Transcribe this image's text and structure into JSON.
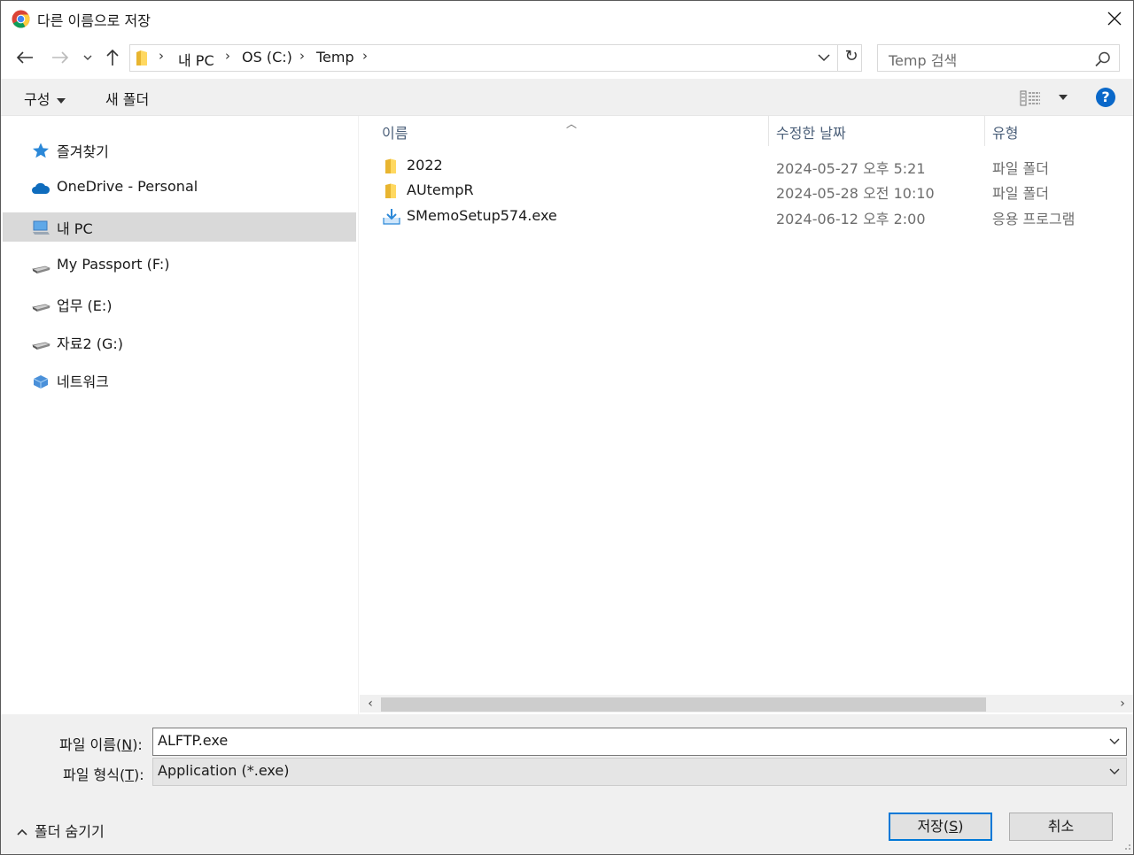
{
  "window": {
    "title": "다른 이름으로 저장",
    "close_icon": "close-icon"
  },
  "nav": {
    "breadcrumbs": [
      "내 PC",
      "OS (C:)",
      "Temp"
    ],
    "search_placeholder": "Temp 검색"
  },
  "toolbar": {
    "organize_label": "구성",
    "new_folder_label": "새 폴더",
    "help_label": "?"
  },
  "sidebar": {
    "items": [
      {
        "label": "즐겨찾기",
        "icon": "star-icon"
      },
      {
        "label": "OneDrive - Personal",
        "icon": "cloud-icon"
      },
      {
        "label": "내 PC",
        "icon": "computer-icon",
        "selected": true
      },
      {
        "label": "My Passport (F:)",
        "icon": "drive-icon"
      },
      {
        "label": "업무 (E:)",
        "icon": "drive-icon"
      },
      {
        "label": "자료2 (G:)",
        "icon": "drive-icon"
      },
      {
        "label": "네트워크",
        "icon": "network-icon"
      }
    ]
  },
  "filelist": {
    "columns": {
      "name": "이름",
      "date": "수정한 날짜",
      "type": "유형"
    },
    "rows": [
      {
        "name": "2022",
        "date": "2024-05-27 오후 5:21",
        "type": "파일 폴더",
        "icon": "folder-icon"
      },
      {
        "name": "AUtempR",
        "date": "2024-05-28 오전 10:10",
        "type": "파일 폴더",
        "icon": "folder-icon"
      },
      {
        "name": "SMemoSetup574.exe",
        "date": "2024-06-12 오후 2:00",
        "type": "응용 프로그램",
        "icon": "installer-icon"
      }
    ]
  },
  "form": {
    "filename_label": "파일 이름",
    "filename_key": "N",
    "filename_value": "ALFTP.exe",
    "filetype_label": "파일 형식",
    "filetype_key": "T",
    "filetype_value": "Application (*.exe)",
    "hide_folders_label": "폴더 숨기기",
    "save_label": "저장",
    "save_key": "S",
    "cancel_label": "취소"
  },
  "colors": {
    "accent": "#0078d7",
    "selected_bg": "#d9d9d9",
    "toolbar_bg": "#f0f0f0"
  }
}
